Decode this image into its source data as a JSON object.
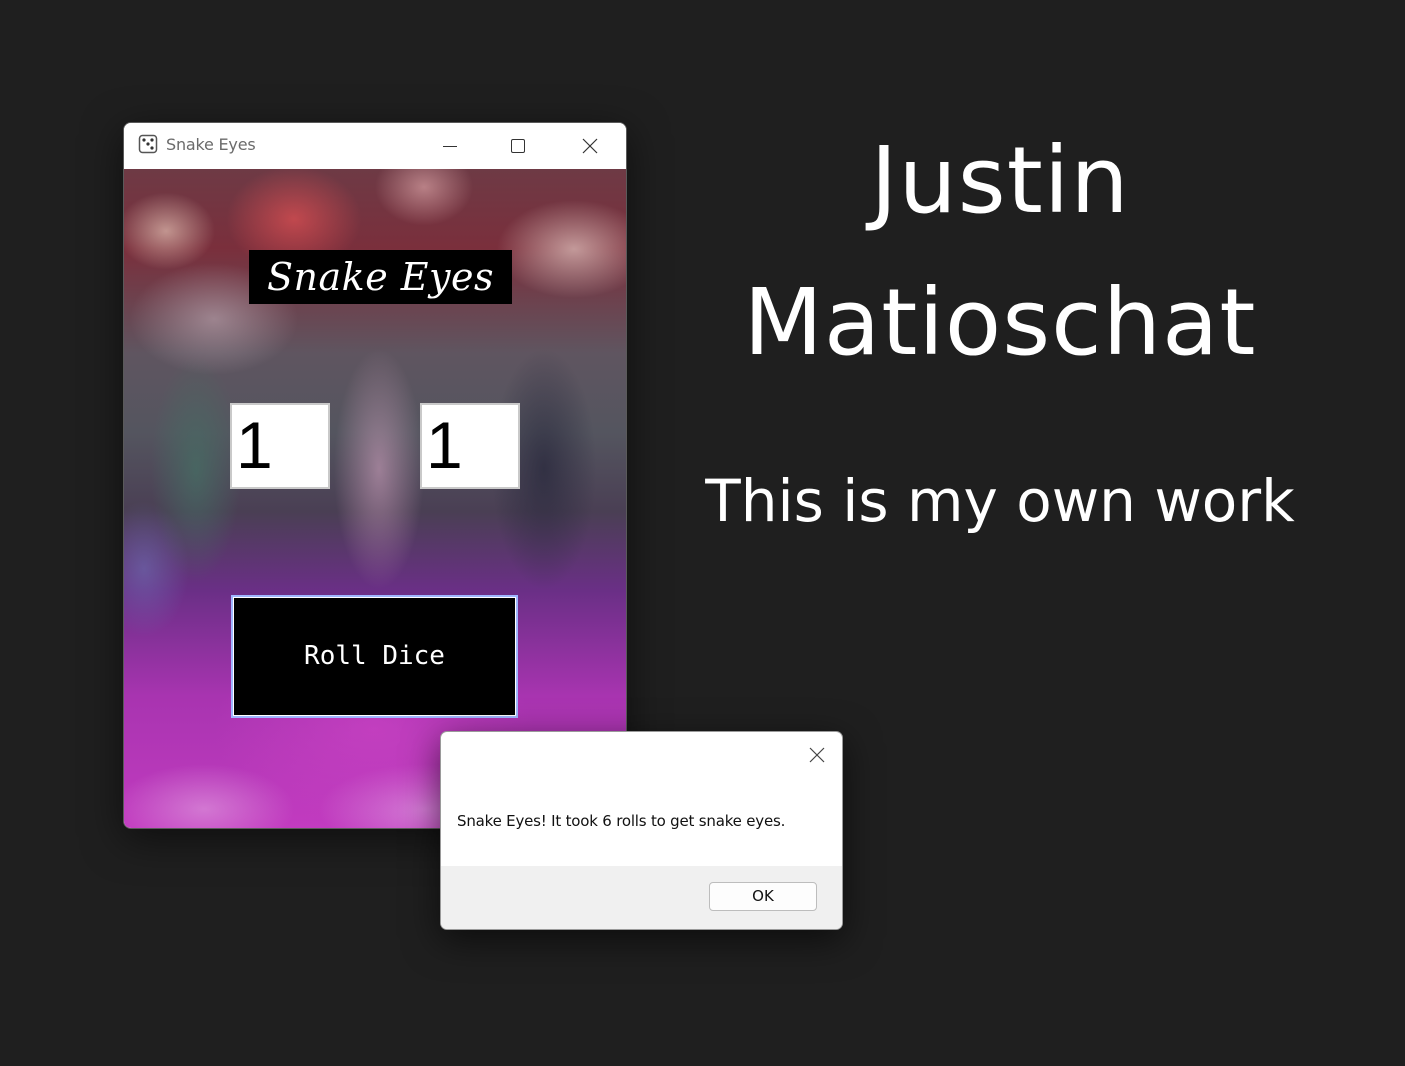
{
  "window": {
    "title": "Snake Eyes",
    "icon": "dice-icon"
  },
  "game": {
    "title": "Snake Eyes",
    "die1": "1",
    "die2": "1",
    "roll_button_label": "Roll Dice"
  },
  "dialog": {
    "message": "Snake Eyes! It took 6 rolls to get snake eyes.",
    "ok_label": "OK"
  },
  "author": {
    "first_name": "Justin",
    "last_name": "Matioschat",
    "statement": "This is my own work"
  }
}
